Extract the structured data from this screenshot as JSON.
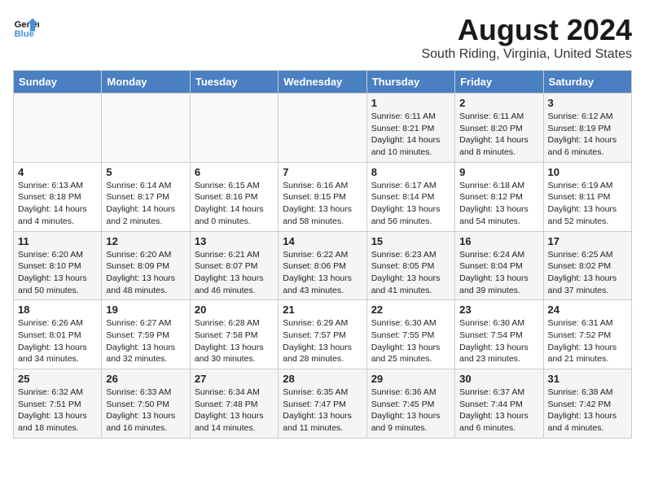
{
  "header": {
    "logo_line1": "General",
    "logo_line2": "Blue",
    "month_year": "August 2024",
    "location": "South Riding, Virginia, United States"
  },
  "weekdays": [
    "Sunday",
    "Monday",
    "Tuesday",
    "Wednesday",
    "Thursday",
    "Friday",
    "Saturday"
  ],
  "weeks": [
    [
      {
        "day": "",
        "info": ""
      },
      {
        "day": "",
        "info": ""
      },
      {
        "day": "",
        "info": ""
      },
      {
        "day": "",
        "info": ""
      },
      {
        "day": "1",
        "info": "Sunrise: 6:11 AM\nSunset: 8:21 PM\nDaylight: 14 hours\nand 10 minutes."
      },
      {
        "day": "2",
        "info": "Sunrise: 6:11 AM\nSunset: 8:20 PM\nDaylight: 14 hours\nand 8 minutes."
      },
      {
        "day": "3",
        "info": "Sunrise: 6:12 AM\nSunset: 8:19 PM\nDaylight: 14 hours\nand 6 minutes."
      }
    ],
    [
      {
        "day": "4",
        "info": "Sunrise: 6:13 AM\nSunset: 8:18 PM\nDaylight: 14 hours\nand 4 minutes."
      },
      {
        "day": "5",
        "info": "Sunrise: 6:14 AM\nSunset: 8:17 PM\nDaylight: 14 hours\nand 2 minutes."
      },
      {
        "day": "6",
        "info": "Sunrise: 6:15 AM\nSunset: 8:16 PM\nDaylight: 14 hours\nand 0 minutes."
      },
      {
        "day": "7",
        "info": "Sunrise: 6:16 AM\nSunset: 8:15 PM\nDaylight: 13 hours\nand 58 minutes."
      },
      {
        "day": "8",
        "info": "Sunrise: 6:17 AM\nSunset: 8:14 PM\nDaylight: 13 hours\nand 56 minutes."
      },
      {
        "day": "9",
        "info": "Sunrise: 6:18 AM\nSunset: 8:12 PM\nDaylight: 13 hours\nand 54 minutes."
      },
      {
        "day": "10",
        "info": "Sunrise: 6:19 AM\nSunset: 8:11 PM\nDaylight: 13 hours\nand 52 minutes."
      }
    ],
    [
      {
        "day": "11",
        "info": "Sunrise: 6:20 AM\nSunset: 8:10 PM\nDaylight: 13 hours\nand 50 minutes."
      },
      {
        "day": "12",
        "info": "Sunrise: 6:20 AM\nSunset: 8:09 PM\nDaylight: 13 hours\nand 48 minutes."
      },
      {
        "day": "13",
        "info": "Sunrise: 6:21 AM\nSunset: 8:07 PM\nDaylight: 13 hours\nand 46 minutes."
      },
      {
        "day": "14",
        "info": "Sunrise: 6:22 AM\nSunset: 8:06 PM\nDaylight: 13 hours\nand 43 minutes."
      },
      {
        "day": "15",
        "info": "Sunrise: 6:23 AM\nSunset: 8:05 PM\nDaylight: 13 hours\nand 41 minutes."
      },
      {
        "day": "16",
        "info": "Sunrise: 6:24 AM\nSunset: 8:04 PM\nDaylight: 13 hours\nand 39 minutes."
      },
      {
        "day": "17",
        "info": "Sunrise: 6:25 AM\nSunset: 8:02 PM\nDaylight: 13 hours\nand 37 minutes."
      }
    ],
    [
      {
        "day": "18",
        "info": "Sunrise: 6:26 AM\nSunset: 8:01 PM\nDaylight: 13 hours\nand 34 minutes."
      },
      {
        "day": "19",
        "info": "Sunrise: 6:27 AM\nSunset: 7:59 PM\nDaylight: 13 hours\nand 32 minutes."
      },
      {
        "day": "20",
        "info": "Sunrise: 6:28 AM\nSunset: 7:58 PM\nDaylight: 13 hours\nand 30 minutes."
      },
      {
        "day": "21",
        "info": "Sunrise: 6:29 AM\nSunset: 7:57 PM\nDaylight: 13 hours\nand 28 minutes."
      },
      {
        "day": "22",
        "info": "Sunrise: 6:30 AM\nSunset: 7:55 PM\nDaylight: 13 hours\nand 25 minutes."
      },
      {
        "day": "23",
        "info": "Sunrise: 6:30 AM\nSunset: 7:54 PM\nDaylight: 13 hours\nand 23 minutes."
      },
      {
        "day": "24",
        "info": "Sunrise: 6:31 AM\nSunset: 7:52 PM\nDaylight: 13 hours\nand 21 minutes."
      }
    ],
    [
      {
        "day": "25",
        "info": "Sunrise: 6:32 AM\nSunset: 7:51 PM\nDaylight: 13 hours\nand 18 minutes."
      },
      {
        "day": "26",
        "info": "Sunrise: 6:33 AM\nSunset: 7:50 PM\nDaylight: 13 hours\nand 16 minutes."
      },
      {
        "day": "27",
        "info": "Sunrise: 6:34 AM\nSunset: 7:48 PM\nDaylight: 13 hours\nand 14 minutes."
      },
      {
        "day": "28",
        "info": "Sunrise: 6:35 AM\nSunset: 7:47 PM\nDaylight: 13 hours\nand 11 minutes."
      },
      {
        "day": "29",
        "info": "Sunrise: 6:36 AM\nSunset: 7:45 PM\nDaylight: 13 hours\nand 9 minutes."
      },
      {
        "day": "30",
        "info": "Sunrise: 6:37 AM\nSunset: 7:44 PM\nDaylight: 13 hours\nand 6 minutes."
      },
      {
        "day": "31",
        "info": "Sunrise: 6:38 AM\nSunset: 7:42 PM\nDaylight: 13 hours\nand 4 minutes."
      }
    ]
  ]
}
